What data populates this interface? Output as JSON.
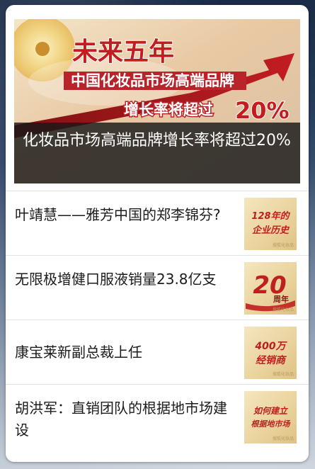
{
  "hero": {
    "banner": {
      "line1": "未来五年",
      "line2": "中国化妆品市场高端品牌",
      "line3": "增长率将超过",
      "percent": "20%"
    },
    "caption": "化妆品市场高端品牌增长率将超过20%"
  },
  "articles": [
    {
      "title": "叶靖慧——雅芳中国的郑李锦芬?",
      "thumb": {
        "line1": "128年的",
        "line2": "企业历史",
        "watermark": "搜狐化妆品"
      }
    },
    {
      "title": "无限极增健口服液销量23.8亿支",
      "thumb": {
        "line1": "20",
        "line2": "周年",
        "watermark": "搜狐化妆品"
      }
    },
    {
      "title": "康宝莱新副总裁上任",
      "thumb": {
        "line1": "400万",
        "line2": "经销商",
        "watermark": "搜狐化妆品"
      }
    },
    {
      "title": "胡洪军：直销团队的根据地市场建设",
      "thumb": {
        "line1": "如何建立",
        "line2": "根据地市场",
        "watermark": "搜狐化妆品"
      }
    }
  ],
  "colors": {
    "banner_red": "#b8242a",
    "thumb_text_red": "#c01f1f",
    "caption_bg": "#191919"
  }
}
